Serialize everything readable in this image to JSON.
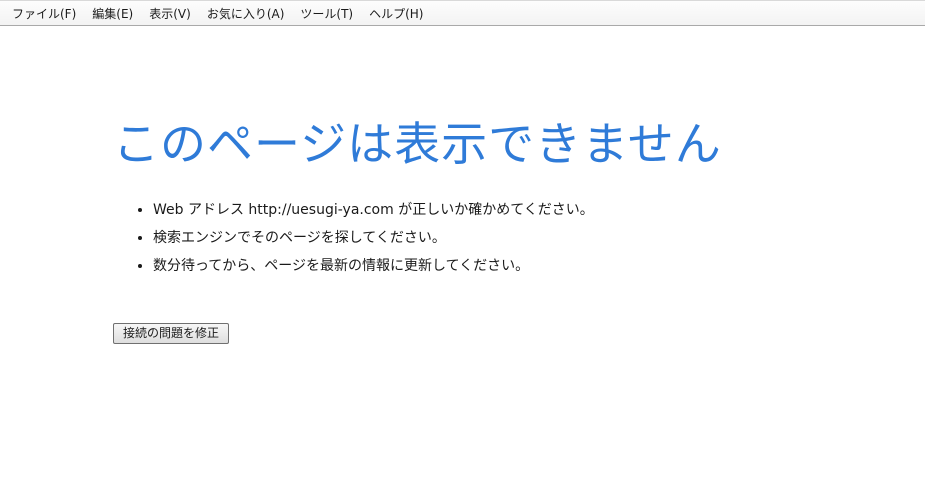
{
  "menubar": {
    "items": [
      "ファイル(F)",
      "編集(E)",
      "表示(V)",
      "お気に入り(A)",
      "ツール(T)",
      "ヘルプ(H)"
    ]
  },
  "error": {
    "title": "このページは表示できません",
    "tips": [
      "Web アドレス http://uesugi-ya.com が正しいか確かめてください。",
      "検索エンジンでそのページを探してください。",
      "数分待ってから、ページを最新の情報に更新してください。"
    ],
    "fix_button_label": "接続の問題を修正"
  },
  "colors": {
    "title": "#2f7bd8",
    "text": "#1a1a1a",
    "background": "#ffffff"
  }
}
